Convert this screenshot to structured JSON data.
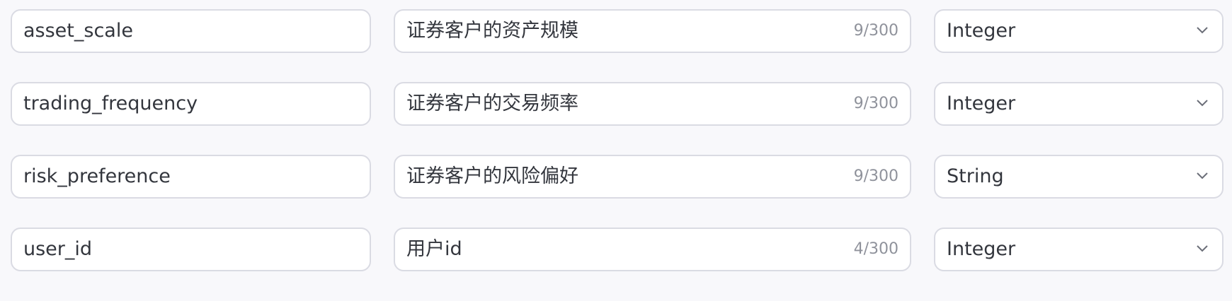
{
  "rows": [
    {
      "name": "asset_scale",
      "description": "证券客户的资产规模",
      "count": "9/300",
      "type": "Integer"
    },
    {
      "name": "trading_frequency",
      "description": "证券客户的交易频率",
      "count": "9/300",
      "type": "Integer"
    },
    {
      "name": "risk_preference",
      "description": "证券客户的风险偏好",
      "count": "9/300",
      "type": "String"
    },
    {
      "name": "user_id",
      "description": "用户id",
      "count": "4/300",
      "type": "Integer"
    }
  ],
  "icons": {
    "select_arrow": "chevron-down-icon"
  },
  "colors": {
    "background": "#f8f8fb",
    "border": "#dadbe3",
    "text": "#33363d",
    "counter": "#8f929b"
  }
}
